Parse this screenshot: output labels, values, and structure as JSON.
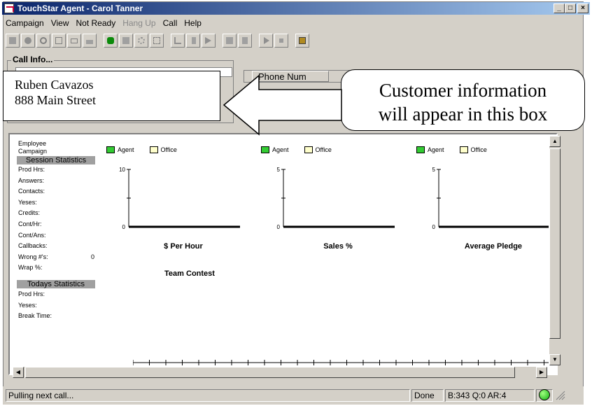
{
  "window": {
    "title": "TouchStar Agent - Carol Tanner",
    "controls": {
      "minimize": "_",
      "maximize": "□",
      "close": "×"
    }
  },
  "menu": {
    "items": [
      "Campaign",
      "View",
      "Not Ready",
      "Hang Up",
      "Call",
      "Help"
    ]
  },
  "toolbar": {
    "icons": [
      "stop-icon",
      "record-icon",
      "no-icon",
      "dial-icon",
      "mail-icon",
      "phone-hand-icon",
      "phone-green-icon",
      "keypad-icon",
      "settings-icon",
      "dialpad-icon",
      "arrow-icon",
      "transfer-icon",
      "forward-icon",
      "conference-icon",
      "hold-icon",
      "play-icon",
      "pause-icon",
      "exit-icon"
    ]
  },
  "call_info": {
    "label": "Call Info...",
    "column_header": "Phone Num"
  },
  "callout_left": {
    "line1": "Ruben Cavazos",
    "line2": "888 Main Street"
  },
  "callout_right": {
    "line1": "Customer information",
    "line2": "will appear in this box"
  },
  "stats": {
    "employee": "Employee",
    "campaign": "Campaign",
    "session_header": "Session Statistics",
    "session": [
      {
        "label": "Prod Hrs:",
        "value": ""
      },
      {
        "label": "Answers:",
        "value": ""
      },
      {
        "label": "Contacts:",
        "value": ""
      },
      {
        "label": "Yeses:",
        "value": ""
      },
      {
        "label": "Credits:",
        "value": ""
      },
      {
        "label": "Cont/Hr:",
        "value": ""
      },
      {
        "label": "Cont/Ans:",
        "value": ""
      },
      {
        "label": "Callbacks:",
        "value": ""
      },
      {
        "label": "Wrong #'s:",
        "value": "0"
      },
      {
        "label": "Wrap %:",
        "value": ""
      }
    ],
    "today_header": "Todays Statistics",
    "today": [
      {
        "label": "Prod Hrs:",
        "value": ""
      },
      {
        "label": "Yeses:",
        "value": ""
      },
      {
        "label": "Break Time:",
        "value": ""
      }
    ]
  },
  "legend": {
    "agent": "Agent",
    "office": "Office",
    "agent_color": "#33cc33",
    "office_color": "#ffffcc"
  },
  "chart_data": [
    {
      "type": "bar",
      "title": "$ Per Hour",
      "ylim": [
        0,
        10
      ],
      "yticks": [
        "10",
        "0"
      ],
      "series": [
        {
          "name": "Agent",
          "values": []
        },
        {
          "name": "Office",
          "values": []
        }
      ]
    },
    {
      "type": "bar",
      "title": "Sales %",
      "ylim": [
        0,
        5
      ],
      "yticks": [
        "5",
        "0"
      ],
      "series": [
        {
          "name": "Agent",
          "values": []
        },
        {
          "name": "Office",
          "values": []
        }
      ]
    },
    {
      "type": "bar",
      "title": "Average Pledge",
      "ylim": [
        0,
        5
      ],
      "yticks": [
        "5",
        "0"
      ],
      "series": [
        {
          "name": "Agent",
          "values": []
        },
        {
          "name": "Office",
          "values": []
        }
      ]
    }
  ],
  "team_contest": {
    "title": "Team Contest"
  },
  "status": {
    "message": "Pulling next call...",
    "state": "Done",
    "counts": "B:343 Q:0 AR:4"
  }
}
